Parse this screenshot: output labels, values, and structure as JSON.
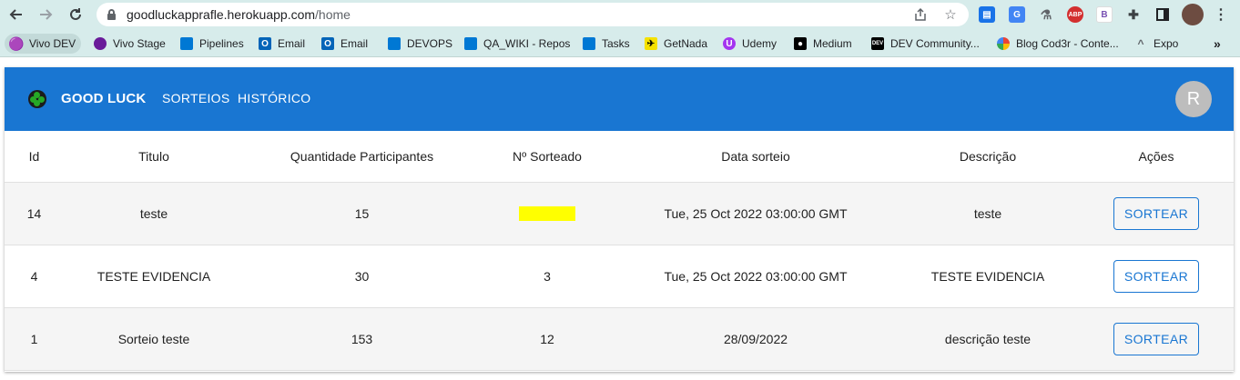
{
  "browser": {
    "url_host": "goodluckapprafle.herokuapp.com",
    "url_path": "/home",
    "bookmarks": [
      {
        "label": "Vivo DEV",
        "icon": "person-icon",
        "color": "#6a1b9a"
      },
      {
        "label": "Vivo Stage",
        "icon": "person-icon",
        "color": "#6a1b9a"
      },
      {
        "label": "Pipelines",
        "icon": "azure-devops-icon",
        "color": "#0078d4"
      },
      {
        "label": "Email",
        "icon": "outlook-icon",
        "color": "#0364b8"
      },
      {
        "label": "Email",
        "icon": "outlook-icon",
        "color": "#0364b8"
      },
      {
        "label": "DEVOPS",
        "icon": "azure-devops-icon",
        "color": "#0078d4"
      },
      {
        "label": "QA_WIKI - Repos",
        "icon": "azure-devops-icon",
        "color": "#0078d4"
      },
      {
        "label": "Tasks",
        "icon": "azure-devops-icon",
        "color": "#0078d4"
      },
      {
        "label": "GetNada",
        "icon": "getnada-icon",
        "color": "#f5e100"
      },
      {
        "label": "Udemy",
        "icon": "udemy-icon",
        "color": "#a435f0"
      },
      {
        "label": "Medium",
        "icon": "medium-icon",
        "color": "#000000"
      },
      {
        "label": "DEV Community...",
        "icon": "dev-icon",
        "color": "#000000"
      },
      {
        "label": "Blog Cod3r - Conte...",
        "icon": "google-icon",
        "color": "#4285f4"
      },
      {
        "label": "Expo",
        "icon": "expo-icon",
        "color": "#ffffff"
      }
    ]
  },
  "app": {
    "brand": "GOOD LUCK",
    "nav": [
      "SORTEIOS",
      "HISTÓRICO"
    ],
    "avatar_initial": "R",
    "primary_color": "#1976d2",
    "highlight_color": "#ffff00"
  },
  "table": {
    "headers": [
      "Id",
      "Titulo",
      "Quantidade Participantes",
      "Nº Sorteado",
      "Data sorteio",
      "Descrição",
      "Ações"
    ],
    "rows": [
      {
        "id": "14",
        "titulo": "teste",
        "quantidade": "15",
        "sorteado": "",
        "data": "Tue, 25 Oct 2022 03:00:00 GMT",
        "descricao": "teste",
        "acao": "SORTEAR"
      },
      {
        "id": "4",
        "titulo": "TESTE EVIDENCIA",
        "quantidade": "30",
        "sorteado": "3",
        "data": "Tue, 25 Oct 2022 03:00:00 GMT",
        "descricao": "TESTE EVIDENCIA",
        "acao": "SORTEAR"
      },
      {
        "id": "1",
        "titulo": "Sorteio teste",
        "quantidade": "153",
        "sorteado": "12",
        "data": "28/09/2022",
        "descricao": "descrição teste",
        "acao": "SORTEAR"
      }
    ]
  }
}
